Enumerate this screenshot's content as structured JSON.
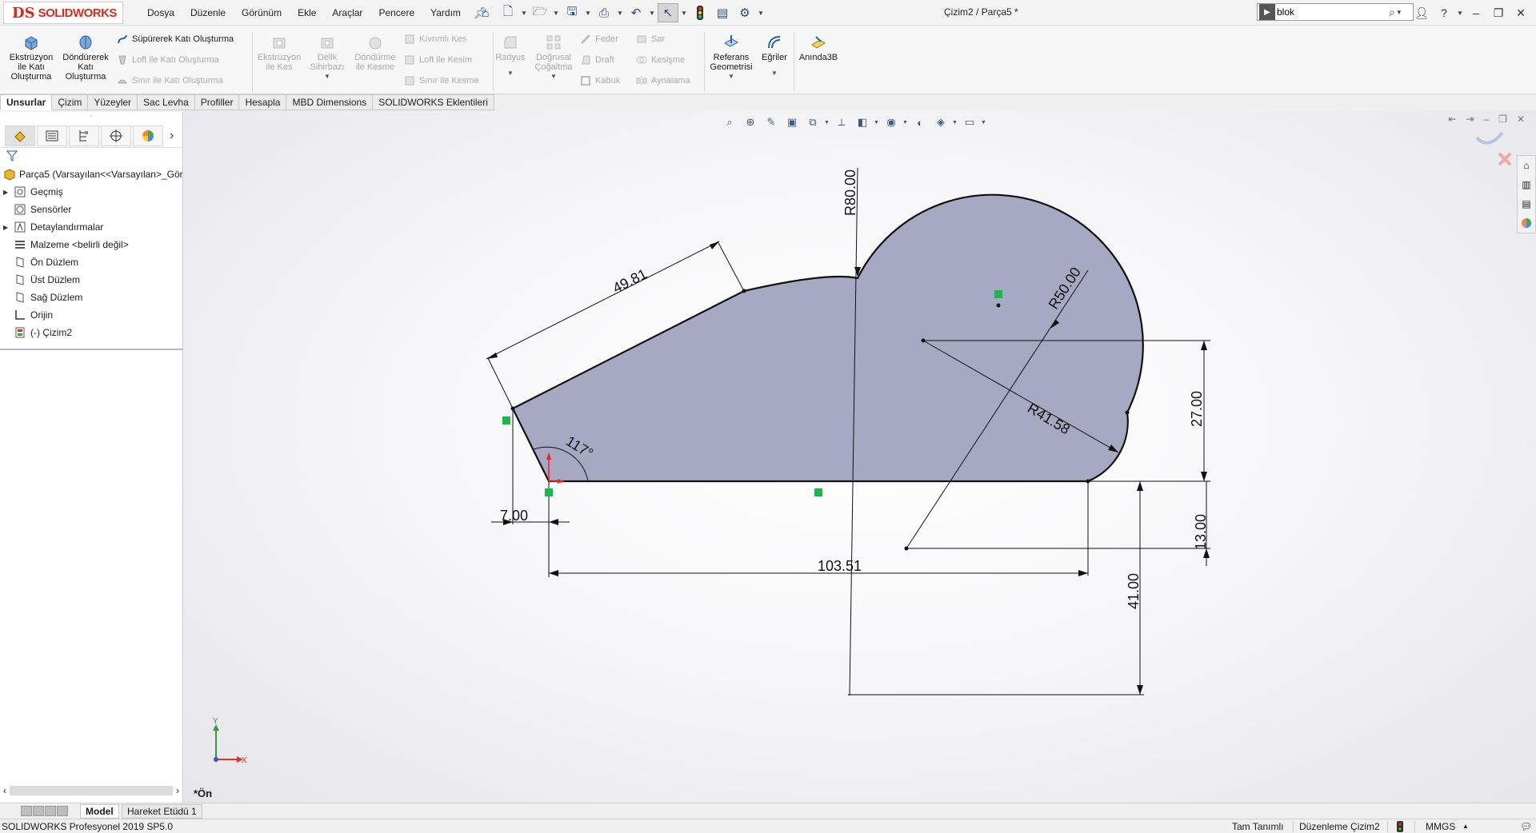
{
  "app": {
    "brand": "SOLIDWORKS",
    "brand_mark": "DS",
    "doc_title": "Çizim2 / Parça5 *"
  },
  "menu": [
    "Dosya",
    "Düzenle",
    "Görünüm",
    "Ekle",
    "Araçlar",
    "Pencere",
    "Yardım"
  ],
  "search": {
    "value": "blok",
    "placeholder": ""
  },
  "ribbon": {
    "extrude": "Ekstrüzyon ile Katı Oluşturma",
    "revolve": "Döndürerek Katı Oluşturma",
    "sweep": "Süpürerek Katı Oluşturma",
    "loft": "Loft ile Katı Oluşturma",
    "boundary": "Sınır ile Katı Oluşturma",
    "extrude_cut": "Ekstrüzyon ile Kes",
    "hole_wizard": "Delik Sihirbazı",
    "revolve_cut": "Döndürme ile Kesme",
    "swept_cut": "Kıvrımlı Kes",
    "loft_cut": "Loft ile Kesim",
    "boundary_cut": "Sınır ile Kesme",
    "fillet": "Radyus",
    "linear_pattern": "Doğrusal Çoğaltma",
    "rib": "Feder",
    "draft": "Draft",
    "shell": "Kabuk",
    "wrap": "Sar",
    "intersect": "Kesişme",
    "mirror": "Aynalama",
    "ref_geometry": "Referans Geometrisi",
    "curves": "Eğriler",
    "instant3d": "Anında3B"
  },
  "tabs": [
    "Unsurlar",
    "Çizim",
    "Yüzeyler",
    "Sac Levha",
    "Profiller",
    "Hesapla",
    "MBD Dimensions",
    "SOLIDWORKS Eklentileri"
  ],
  "tree": {
    "root": "Parça5  (Varsayılan<<Varsayılan>_Gör",
    "items": [
      "Geçmiş",
      "Sensörler",
      "Detaylandırmalar",
      "Malzeme <belirli değil>",
      "Ön Düzlem",
      "Üst Düzlem",
      "Sağ Düzlem",
      "Orijin",
      "(-) Çizim2"
    ]
  },
  "sketch": {
    "dims": {
      "d1": "49.81",
      "d2": "R80.00",
      "d3": "R50.00",
      "d4": "R41.58",
      "d5": "27.00",
      "d6": "13.00",
      "d7": "41.00",
      "d8": "103.51",
      "d9": "7.00",
      "d10": "117°"
    },
    "fill_color": "#a7a9c2",
    "triad": {
      "x": "X",
      "y": "Y"
    }
  },
  "view_name": "*Ön",
  "bottom_tabs": [
    "Model",
    "Hareket Etüdü 1"
  ],
  "status": {
    "product": "SOLIDWORKS Profesyonel 2019 SP5.0",
    "defined": "Tam Tanımlı",
    "editing": "Düzenleme Çizim2",
    "units": "MMGS"
  },
  "colors": {
    "accent_red": "#d52b1e",
    "selection_green": "#18b84a",
    "icon_blue": "#2b5fa6"
  }
}
